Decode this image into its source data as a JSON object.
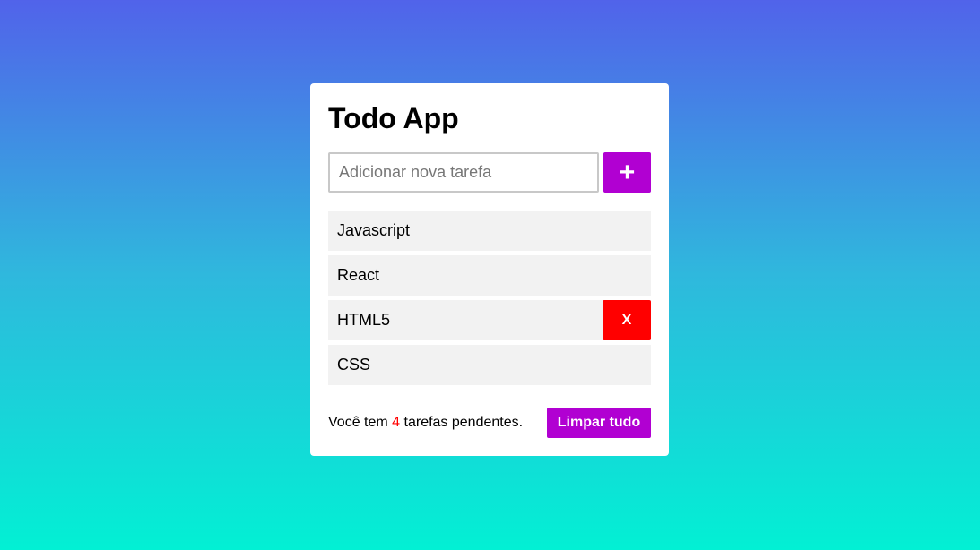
{
  "app": {
    "title": "Todo App"
  },
  "input": {
    "placeholder": "Adicionar nova tarefa",
    "value": "",
    "add_label": "+"
  },
  "todos": [
    {
      "label": "Javascript"
    },
    {
      "label": "React"
    },
    {
      "label": "HTML5",
      "delete_label": "X"
    },
    {
      "label": "CSS"
    }
  ],
  "footer": {
    "prefix": "Você tem",
    "count": "4",
    "suffix": "tarefas pendentes.",
    "clear_label": "Limpar tudo"
  },
  "colors": {
    "accent": "#b100d2",
    "delete": "#ff0000",
    "count": "#ff0000",
    "item_bg": "#f2f2f2",
    "gradient_top": "#5163ea",
    "gradient_bottom": "#02f0d4"
  }
}
